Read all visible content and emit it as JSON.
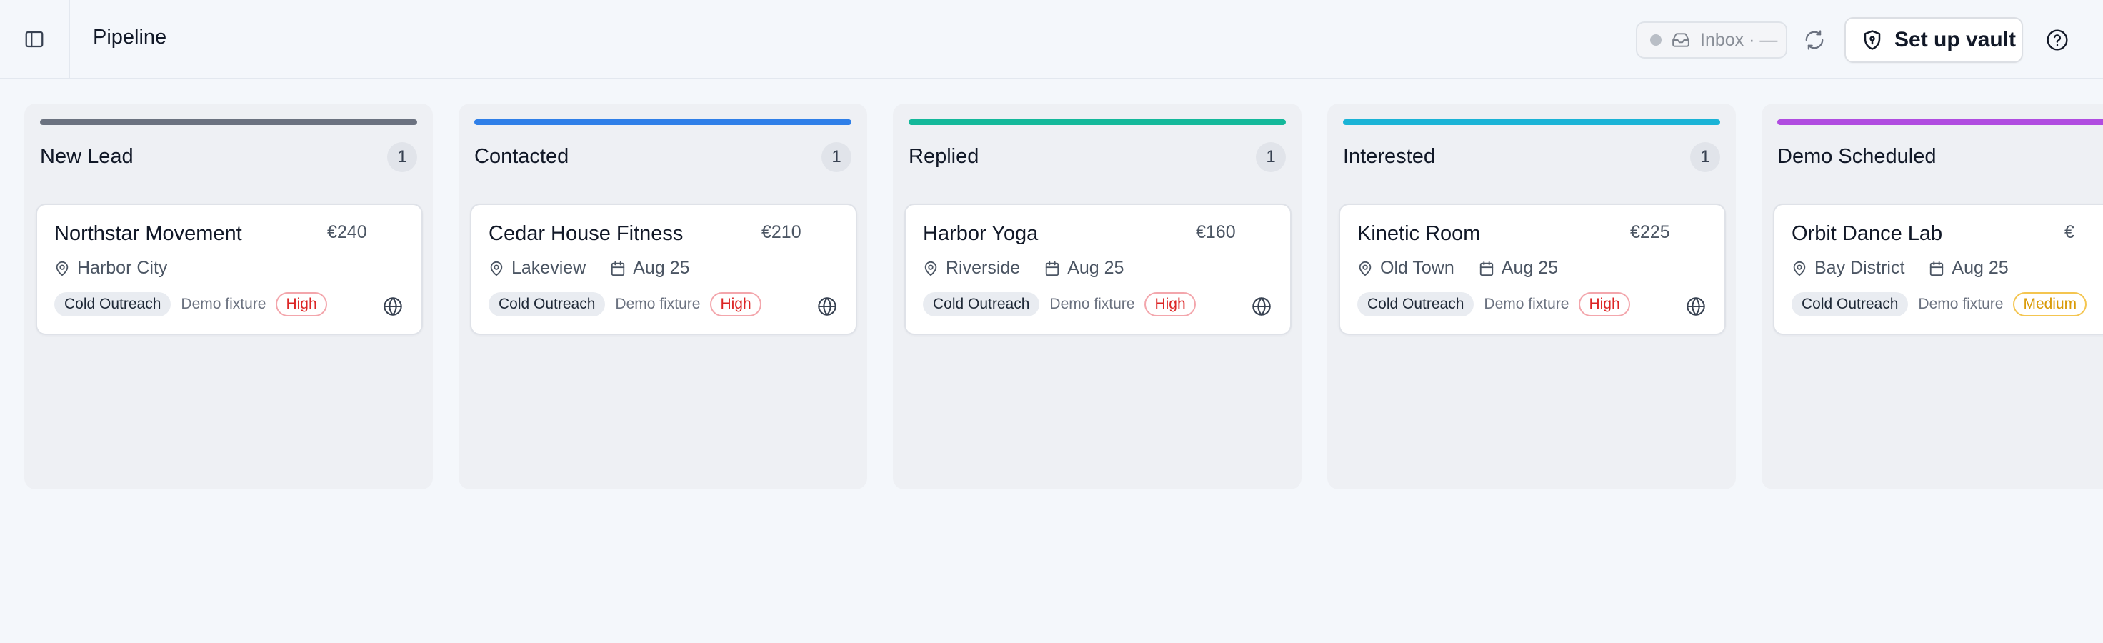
{
  "header": {
    "title": "Pipeline",
    "inbox_label": "Inbox · —",
    "vault_label": "Set up vault"
  },
  "colors": {
    "new_lead": "#6b7280",
    "contacted": "#2f7fe8",
    "replied": "#14b89a",
    "interested": "#1ab3d6",
    "demo_scheduled": "#b04ce0",
    "priority_high": "#dc2626",
    "priority_medium": "#d99a06"
  },
  "columns": [
    {
      "title": "New Lead",
      "count": "1",
      "card": {
        "name": "Northstar Movement",
        "price": "€240",
        "location": "Harbor City",
        "date": "",
        "source": "Cold Outreach",
        "fixture": "Demo fixture",
        "priority": "High"
      }
    },
    {
      "title": "Contacted",
      "count": "1",
      "card": {
        "name": "Cedar House Fitness",
        "price": "€210",
        "location": "Lakeview",
        "date": "Aug 25",
        "source": "Cold Outreach",
        "fixture": "Demo fixture",
        "priority": "High"
      }
    },
    {
      "title": "Replied",
      "count": "1",
      "card": {
        "name": "Harbor Yoga",
        "price": "€160",
        "location": "Riverside",
        "date": "Aug 25",
        "source": "Cold Outreach",
        "fixture": "Demo fixture",
        "priority": "High"
      }
    },
    {
      "title": "Interested",
      "count": "1",
      "card": {
        "name": "Kinetic Room",
        "price": "€225",
        "location": "Old Town",
        "date": "Aug 25",
        "source": "Cold Outreach",
        "fixture": "Demo fixture",
        "priority": "High"
      }
    },
    {
      "title": "Demo Scheduled",
      "count": "",
      "card": {
        "name": "Orbit Dance Lab",
        "price": "€",
        "location": "Bay District",
        "date": "Aug 25",
        "source": "Cold Outreach",
        "fixture": "Demo fixture",
        "priority": "Medium"
      }
    }
  ]
}
